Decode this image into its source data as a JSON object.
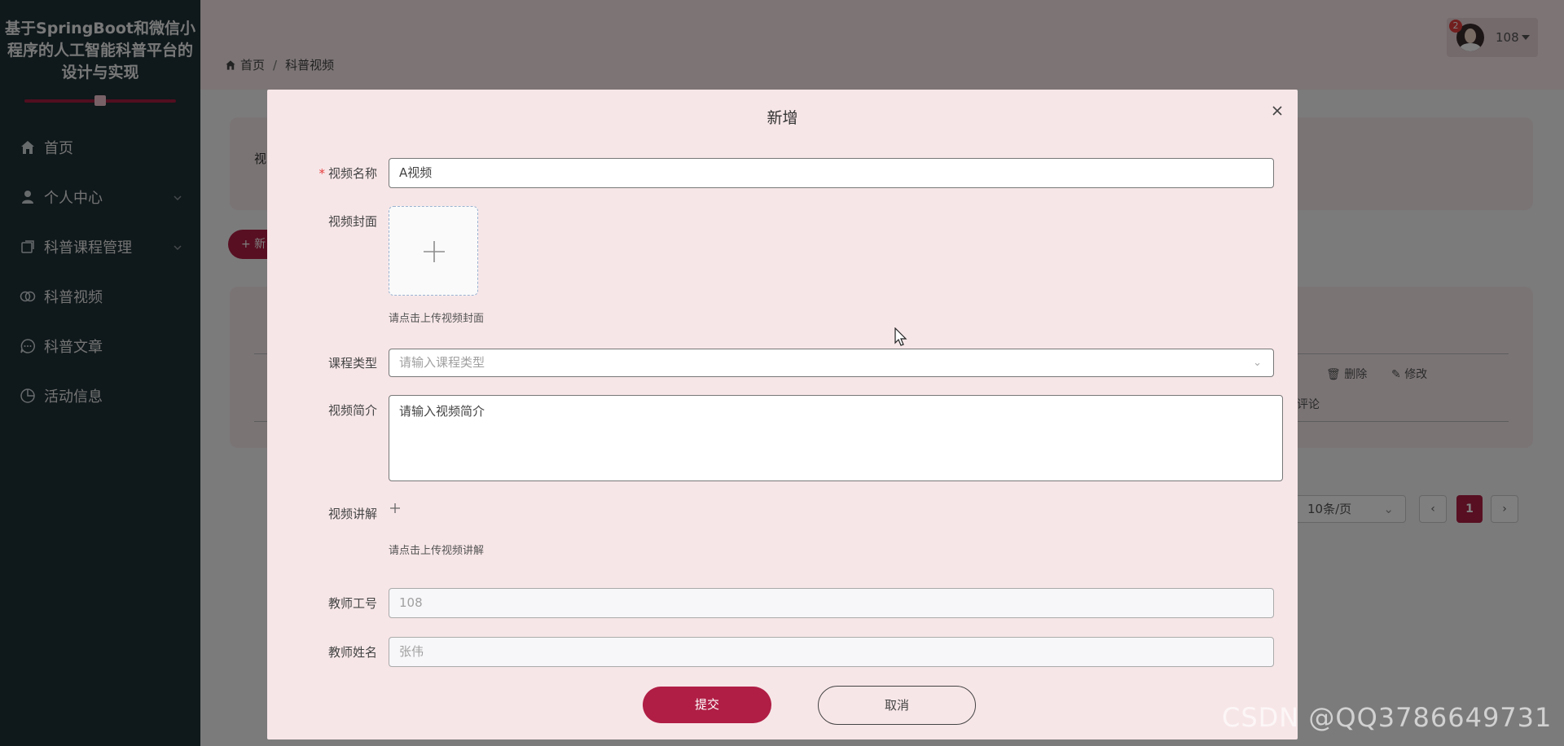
{
  "sidebar": {
    "title": "基于SpringBoot和微信小程序的人工智能科普平台的设计与实现",
    "items": [
      {
        "label": "首页",
        "icon": "home-icon"
      },
      {
        "label": "个人中心",
        "icon": "user-icon"
      },
      {
        "label": "科普课程管理",
        "icon": "course-icon"
      },
      {
        "label": "科普视频",
        "icon": "video-icon"
      },
      {
        "label": "科普文章",
        "icon": "chat-icon"
      },
      {
        "label": "活动信息",
        "icon": "pie-icon"
      }
    ]
  },
  "header": {
    "user_name": "108",
    "badge_count": "2",
    "breadcrumb": {
      "home": "首页",
      "current": "科普视频"
    }
  },
  "background": {
    "search_label": "视",
    "add_button": "+ 新",
    "delete_label": "删除",
    "edit_label": "修改",
    "comment_label": "评论",
    "page_size": "10条/页",
    "current_page": "1"
  },
  "dialog": {
    "title": "新增",
    "fields": {
      "video_name": {
        "label": "视频名称",
        "value": "A视频",
        "required": true
      },
      "cover": {
        "label": "视频封面",
        "hint": "请点击上传视频封面"
      },
      "course_type": {
        "label": "课程类型",
        "placeholder": "请输入课程类型"
      },
      "intro": {
        "label": "视频简介",
        "value": "请输入视频简介"
      },
      "lecture": {
        "label": "视频讲解",
        "hint": "请点击上传视频讲解"
      },
      "teacher_id": {
        "label": "教师工号",
        "value": "108"
      },
      "teacher_name": {
        "label": "教师姓名",
        "value": "张伟"
      }
    },
    "submit_label": "提交",
    "cancel_label": "取消"
  },
  "watermark": "CSDN @QQ3786649731",
  "colors": {
    "accent": "#b01e45",
    "sidebar": "#1f3036",
    "dialog": "#f7e6e8"
  }
}
